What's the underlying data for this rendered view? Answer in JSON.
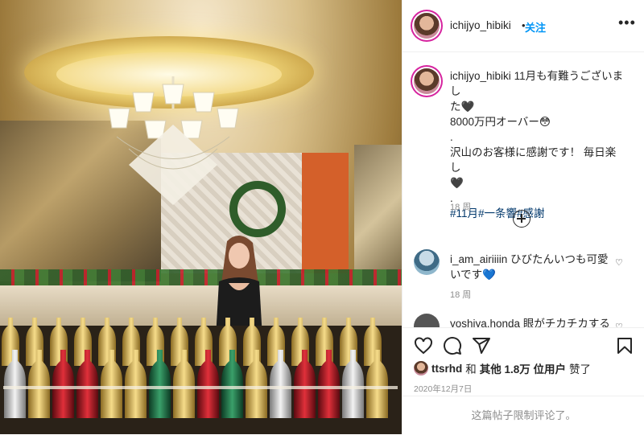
{
  "post": {
    "author": "ichijyo_hibiki",
    "follow_label": "关注",
    "more_label": "•••",
    "caption_lines": [
      "11月も有難うございまし",
      "た🖤",
      "8000万円オーバー😳",
      ".",
      "沢山のお客様に感謝です！ 毎日楽し",
      "🖤",
      "."
    ],
    "hashtags": "#11月#一条響#感謝",
    "caption_time": "18 周",
    "comments": [
      {
        "user": "i_am_airiiiin",
        "text": "ひびたんいつも可愛いです💙",
        "time": "18 周"
      },
      {
        "user": "yoshiya.honda",
        "text": "眼がチカチカする"
      }
    ],
    "likes": {
      "user": "ttsrhd",
      "text_and": "和",
      "others": "其他 1.8万 位用户",
      "liked": "赞了"
    },
    "date": "2020年12月7日",
    "footer": "这篇帖子限制评论了。"
  },
  "icons": {
    "more": "more-dots-icon",
    "load_more": "plus-circle-icon",
    "like": "heart-icon",
    "comment": "comment-icon",
    "share": "share-icon",
    "save": "bookmark-icon",
    "comment_like": "heart-small-icon"
  },
  "colors": {
    "accent": "#0095f6",
    "hashtag": "#00376b",
    "muted": "#8e8e8e",
    "story_ring": "#d6249f"
  }
}
